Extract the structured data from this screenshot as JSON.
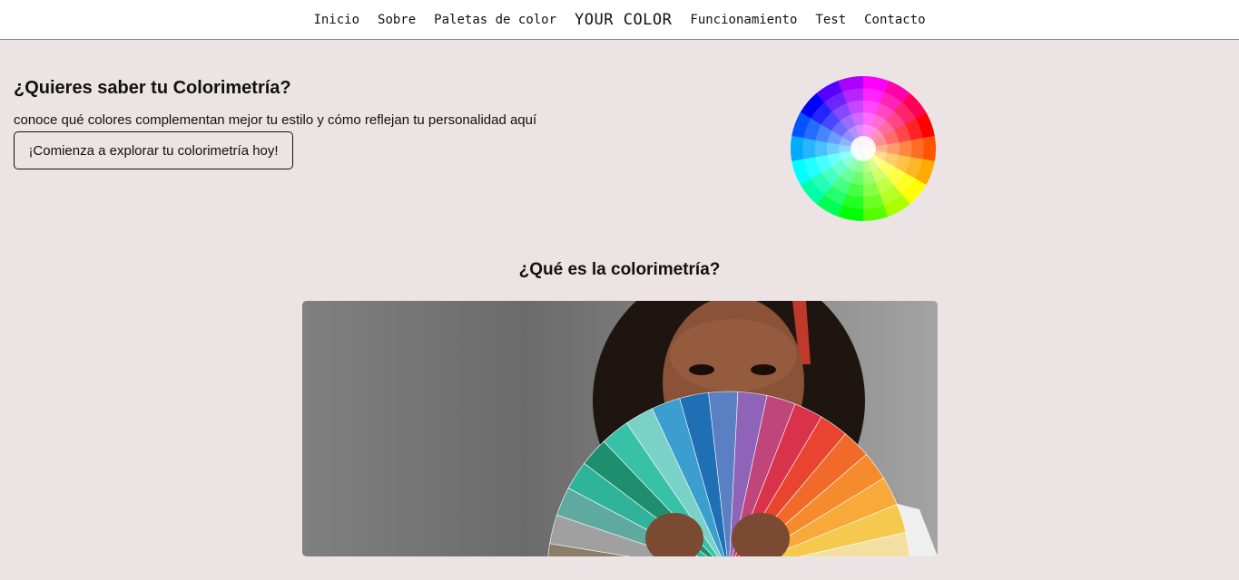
{
  "nav": {
    "items": [
      "Inicio",
      "Sobre",
      "Paletas de color",
      "YOUR COLOR",
      "Funcionamiento",
      "Test",
      "Contacto"
    ]
  },
  "hero": {
    "title": "¿Quieres saber tu Colorimetría?",
    "subtitle": "conoce qué colores complementan mejor tu estilo y cómo reflejan tu personalidad aquí",
    "button_label": "¡Comienza a explorar tu colorimetría hoy!"
  },
  "section": {
    "title": "¿Qué es la colorimetría?"
  },
  "icons": {
    "hero_image": "color-wheel-icon",
    "section_image": "woman-holding-color-fan-photo"
  },
  "colors": {
    "page_background": "#ebe3e4",
    "nav_background": "#ffffff",
    "text": "#111111"
  }
}
